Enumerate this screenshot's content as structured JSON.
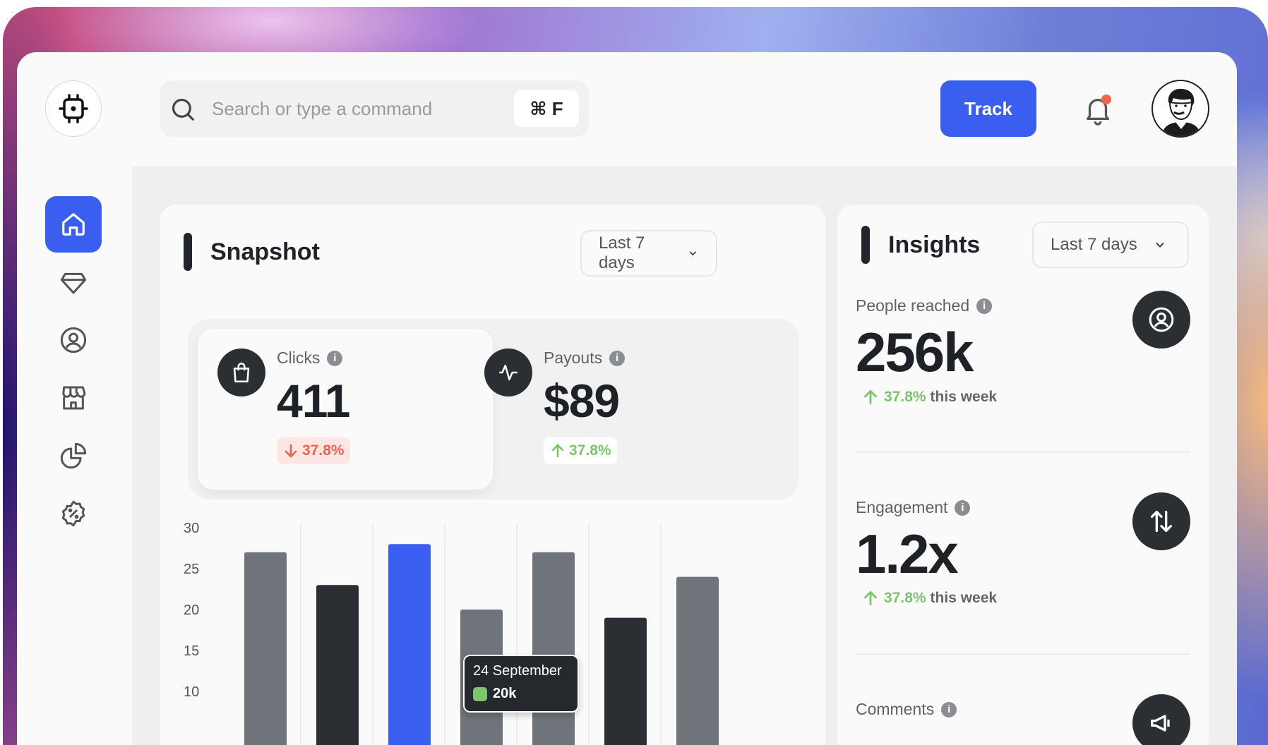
{
  "search": {
    "placeholder": "Search or type a command",
    "shortcut": "⌘ F"
  },
  "header": {
    "track_label": "Track"
  },
  "sidebar": {
    "items": [
      {
        "name": "home-icon",
        "active": true
      },
      {
        "name": "diamond-icon",
        "active": false
      },
      {
        "name": "user-circle-icon",
        "active": false
      },
      {
        "name": "store-icon",
        "active": false
      },
      {
        "name": "pie-chart-icon",
        "active": false
      },
      {
        "name": "discount-badge-icon",
        "active": false
      }
    ]
  },
  "snapshot": {
    "title": "Snapshot",
    "range": "Last 7 days",
    "metrics": [
      {
        "label": "Clicks",
        "value": "411",
        "change": "37.8%",
        "direction": "down"
      },
      {
        "label": "Payouts",
        "value": "$89",
        "change": "37.8%",
        "direction": "up"
      }
    ]
  },
  "chart_data": {
    "type": "bar",
    "y_ticks": [
      "30",
      "25",
      "20",
      "15",
      "10"
    ],
    "ylim": [
      10,
      30
    ],
    "values": [
      27,
      23,
      28,
      20,
      27,
      19,
      24
    ],
    "colors": [
      "#6f737a",
      "#2b2e33",
      "#3a5ef0",
      "#6f737a",
      "#6f737a",
      "#2b2e33",
      "#6f737a"
    ],
    "highlight_index": 2,
    "tooltip": {
      "date": "24 September",
      "value": "20k",
      "swatch_color": "#7cc46d"
    }
  },
  "insights": {
    "title": "Insights",
    "range": "Last 7 days",
    "items": [
      {
        "label": "People reached",
        "value": "256k",
        "change": "37.8%",
        "period": "this week"
      },
      {
        "label": "Engagement",
        "value": "1.2x",
        "change": "37.8%",
        "period": "this week"
      },
      {
        "label": "Comments",
        "value": "",
        "change": "",
        "period": ""
      }
    ]
  },
  "colors": {
    "accent": "#3a5ef0",
    "dark": "#2b2e33",
    "positive": "#7cc46d",
    "negative": "#f0644c",
    "notification": "#f0644c"
  }
}
